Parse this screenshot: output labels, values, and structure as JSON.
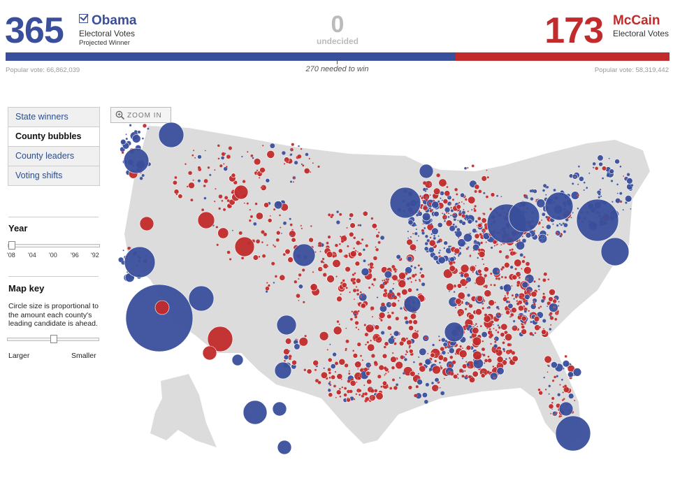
{
  "header": {
    "obama": {
      "votes": "365",
      "name": "Obama",
      "label": "Electoral Votes",
      "status": "Projected Winner",
      "popular": "Popular vote: 66,862,039",
      "color": "#3a4f9c"
    },
    "mccain": {
      "votes": "173",
      "name": "McCain",
      "label": "Electoral Votes",
      "popular": "Popular vote: 58,319,442",
      "color": "#c12b2b"
    },
    "undecided": {
      "count": "0",
      "label": "undecided"
    },
    "needed": "270 needed to win",
    "bar_share_obama": 0.678
  },
  "sidebar": {
    "views": [
      {
        "label": "State winners",
        "active": false
      },
      {
        "label": "County bubbles",
        "active": true
      },
      {
        "label": "County leaders",
        "active": false
      },
      {
        "label": "Voting shifts",
        "active": false
      }
    ],
    "year": {
      "heading": "Year",
      "ticks": [
        "'08",
        "'04",
        "'00",
        "'96",
        "'92"
      ],
      "selected": "'08"
    },
    "map_key": {
      "heading": "Map key",
      "text": "Circle size is proportional to the amount each county's leading candidate is ahead.",
      "larger": "Larger",
      "smaller": "Smaller",
      "slider_value": 0.5
    }
  },
  "map": {
    "zoom_label": "ZOOM IN",
    "zoom_icon": "magnifier-plus-icon",
    "land_color": "#dcdcdc",
    "dem_color": "#3a4f9c",
    "rep_color": "#c12b2b"
  }
}
